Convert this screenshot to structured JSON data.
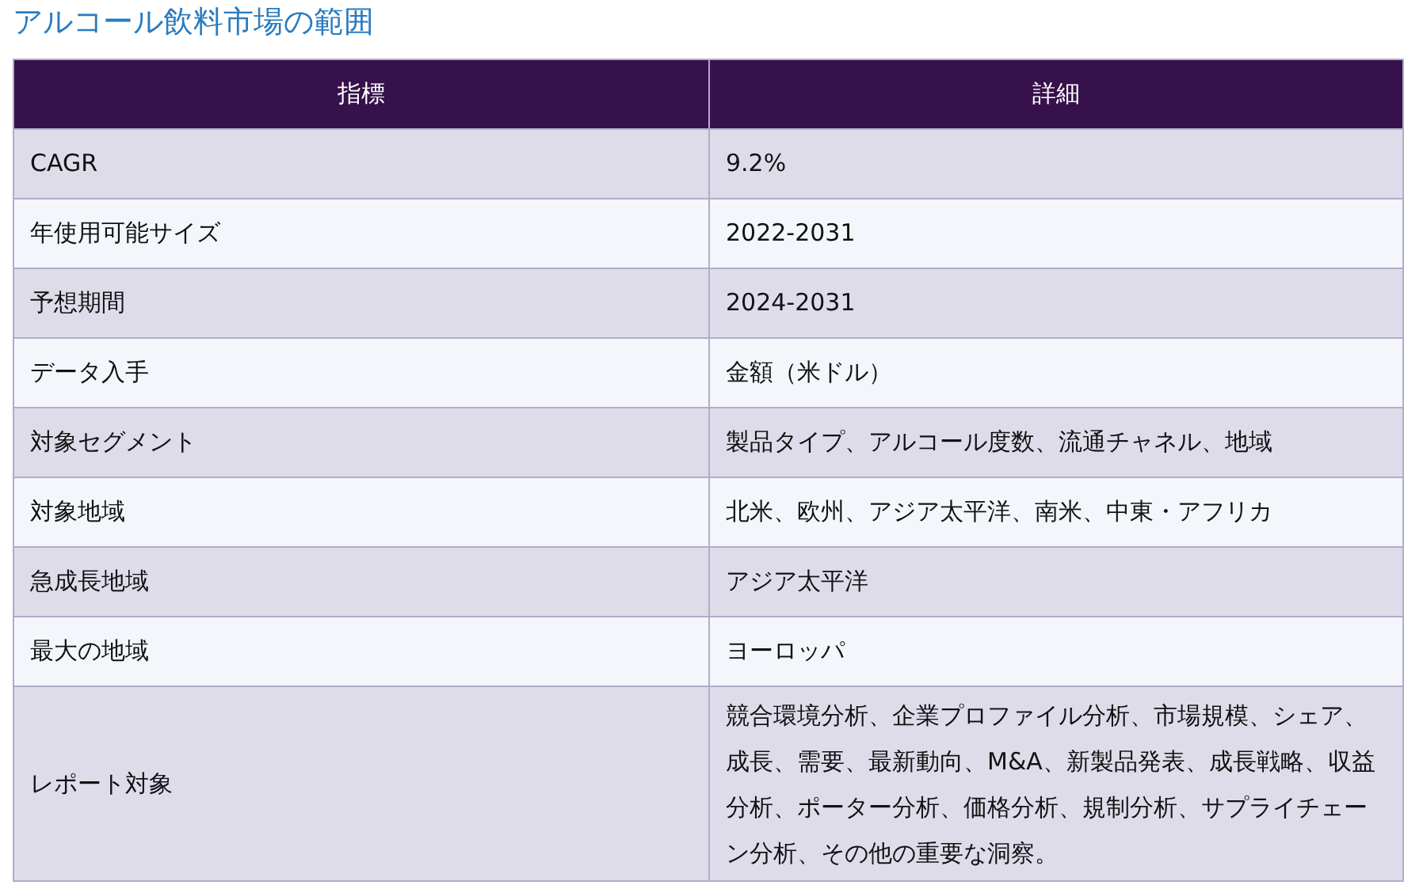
{
  "title": "アルコール飲料市場の範囲",
  "table": {
    "columns": [
      "指標",
      "詳細"
    ],
    "rows": [
      [
        "CAGR",
        "9.2%"
      ],
      [
        "年使用可能サイズ",
        "2022-2031"
      ],
      [
        "予想期間",
        "2024-2031"
      ],
      [
        "データ入手",
        "金額（米ドル）"
      ],
      [
        "対象セグメント",
        "製品タイプ、アルコール度数、流通チャネル、地域"
      ],
      [
        "対象地域",
        "北米、欧州、アジア太平洋、南米、中東・アフリカ"
      ],
      [
        "急成長地域",
        "アジア太平洋"
      ],
      [
        "最大の地域",
        "ヨーロッパ"
      ],
      [
        "レポート対象",
        "競合環境分析、企業プロファイル分析、市場規模、シェア、成長、需要、最新動向、M&A、新製品発表、成長戦略、収益分析、ポーター分析、価格分析、規制分析、サプライチェーン分析、その他の重要な洞察。"
      ]
    ]
  }
}
